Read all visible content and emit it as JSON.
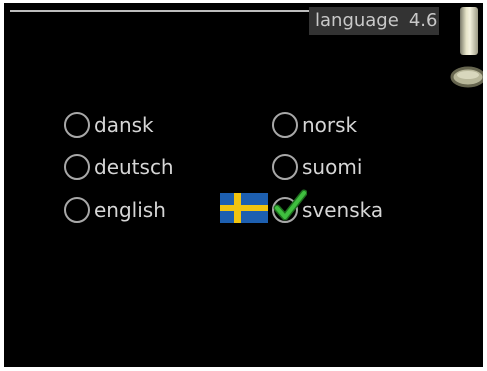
{
  "header": {
    "title": "language",
    "number": "4.6"
  },
  "colors": {
    "background": "#000000",
    "text": "#d6d6d6",
    "title_bar": "#333333",
    "check": "#3aa83a",
    "flag_blue": "#1d5fb0",
    "flag_yellow": "#f1c40f"
  },
  "languages": {
    "dansk": {
      "label": "dansk",
      "selected": false
    },
    "norsk": {
      "label": "norsk",
      "selected": false
    },
    "deutsch": {
      "label": "deutsch",
      "selected": false
    },
    "suomi": {
      "label": "suomi",
      "selected": false
    },
    "english": {
      "label": "english",
      "selected": false
    },
    "svenska": {
      "label": "svenska",
      "selected": true
    }
  },
  "icons": {
    "scrollbar": "scrollbar-handle",
    "knob": "selector-knob",
    "flag": "sweden-flag-icon",
    "check": "checkmark-icon"
  }
}
